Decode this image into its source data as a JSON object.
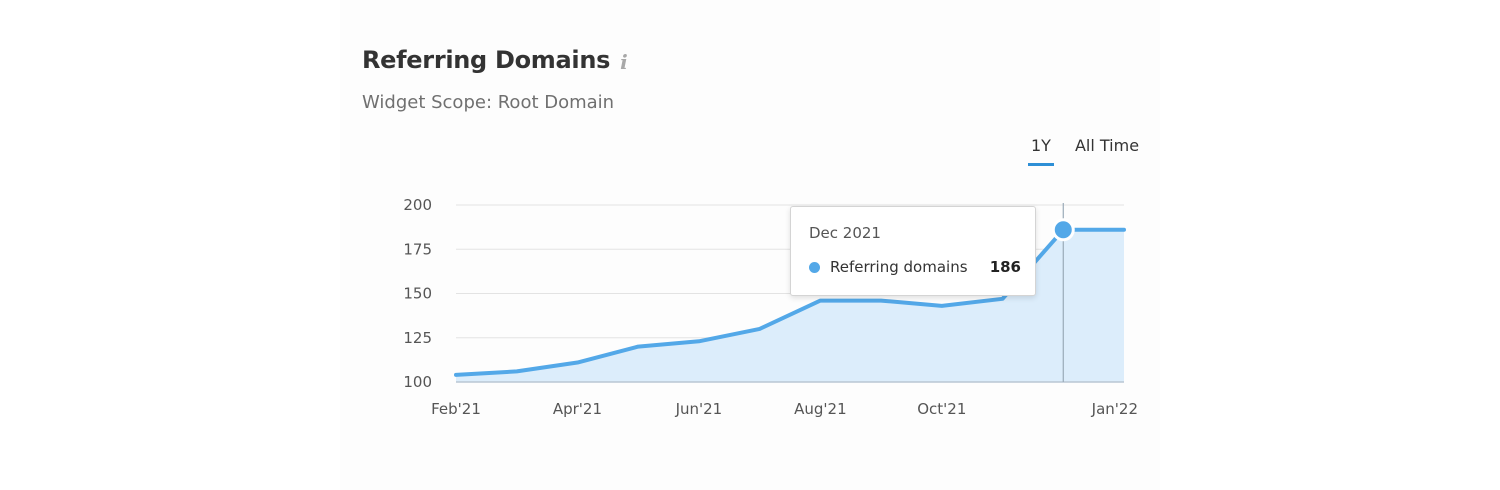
{
  "header": {
    "title": "Referring Domains",
    "info_icon": "i",
    "subtitle": "Widget Scope: Root Domain"
  },
  "range_tabs": [
    {
      "label": "1Y",
      "active": true
    },
    {
      "label": "All Time",
      "active": false
    }
  ],
  "tooltip": {
    "date": "Dec 2021",
    "label": "Referring domains",
    "value": "186"
  },
  "colors": {
    "line": "#53a8e8",
    "area": "#dcedfb",
    "grid": "#e3e3e3",
    "accent": "#2e8fd6"
  },
  "chart_data": {
    "type": "area",
    "x": [
      "Feb'21",
      "Mar'21",
      "Apr'21",
      "May'21",
      "Jun'21",
      "Jul'21",
      "Aug'21",
      "Sep'21",
      "Oct'21",
      "Nov'21",
      "Dec'21",
      "Jan'22"
    ],
    "x_tick_labels": [
      "Feb'21",
      "",
      "Apr'21",
      "",
      "Jun'21",
      "",
      "Aug'21",
      "",
      "Oct'21",
      "",
      "",
      "Jan'22"
    ],
    "series": [
      {
        "name": "Referring domains",
        "values": [
          104,
          106,
          111,
          120,
          123,
          130,
          146,
          146,
          143,
          147,
          186,
          186
        ]
      }
    ],
    "y_ticks": [
      100,
      125,
      150,
      175,
      200
    ],
    "ylim": [
      100,
      200
    ],
    "highlighted_index": 10,
    "grid": true
  }
}
